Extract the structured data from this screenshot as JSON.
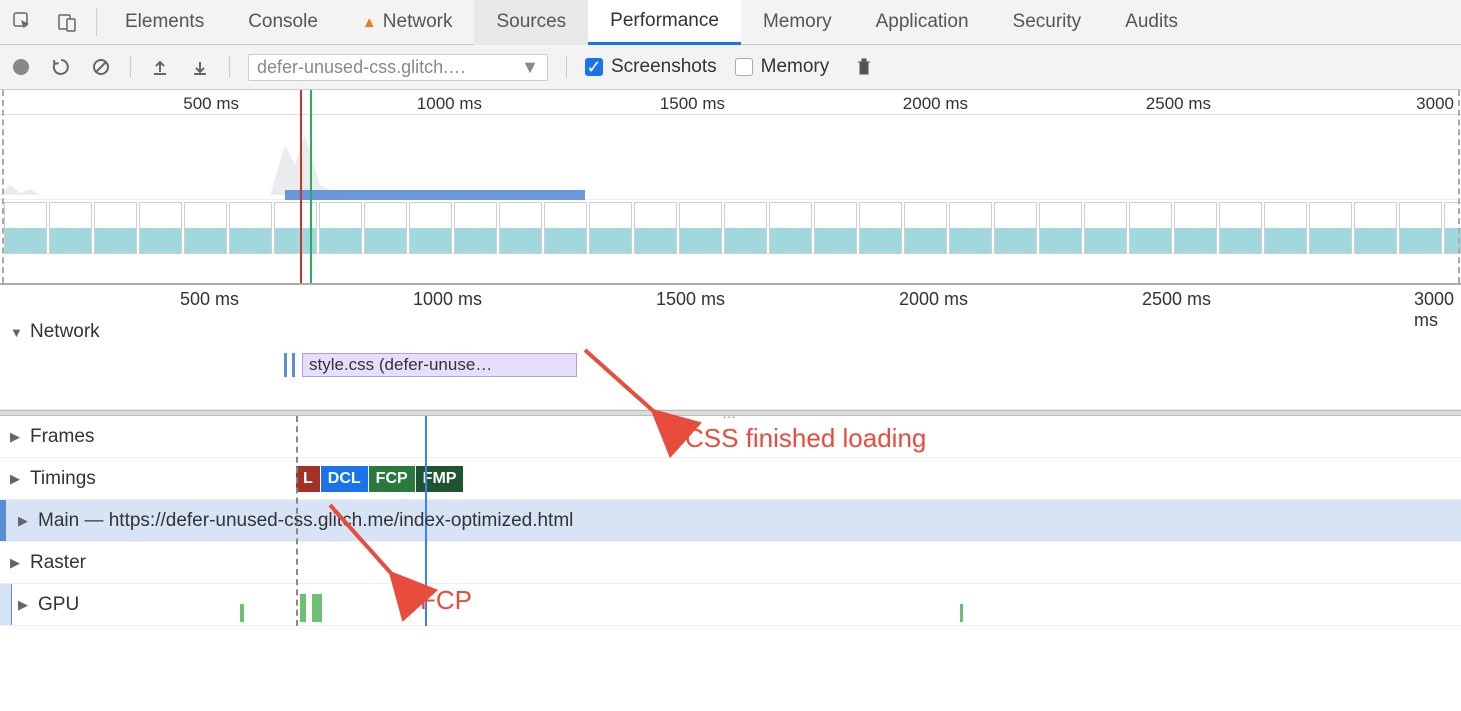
{
  "tabs": {
    "elements": "Elements",
    "console": "Console",
    "network": "Network",
    "sources": "Sources",
    "performance": "Performance",
    "memory": "Memory",
    "application": "Application",
    "security": "Security",
    "audits": "Audits"
  },
  "toolbar": {
    "dropdown": "defer-unused-css.glitch.…",
    "screenshots": "Screenshots",
    "memory": "Memory"
  },
  "overview_ruler": [
    "500 ms",
    "1000 ms",
    "1500 ms",
    "2000 ms",
    "2500 ms",
    "3000"
  ],
  "detail_ruler": [
    "500 ms",
    "1000 ms",
    "1500 ms",
    "2000 ms",
    "2500 ms",
    "3000 ms"
  ],
  "tracks": {
    "network": "Network",
    "frames": "Frames",
    "timings": "Timings",
    "main": "Main — https://defer-unused-css.glitch.me/index-optimized.html",
    "raster": "Raster",
    "gpu": "GPU"
  },
  "network_item": "style.css (defer-unuse…",
  "timings": {
    "L": "L",
    "DCL": "DCL",
    "FCP": "FCP",
    "FMP": "FMP"
  },
  "annotations": {
    "css_loaded": "CSS finished loading",
    "fcp": "FCP"
  }
}
